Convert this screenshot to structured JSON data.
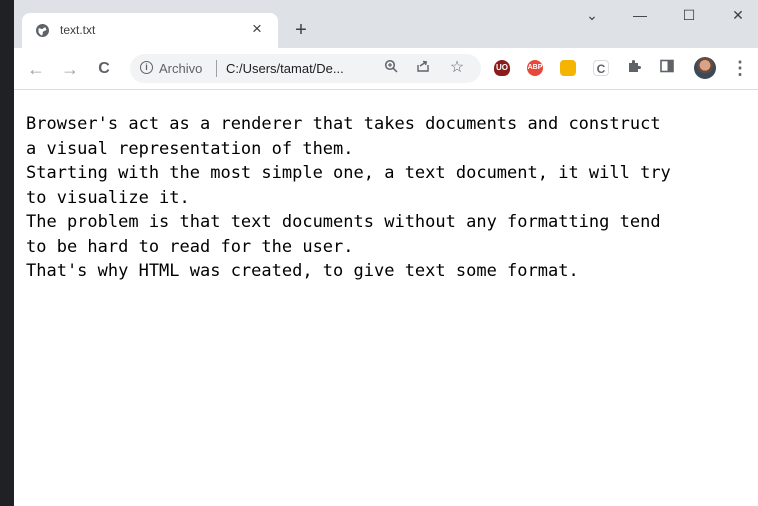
{
  "tab": {
    "title": "text.txt",
    "close": "×",
    "new_tab": "+"
  },
  "window_controls": {
    "dropdown": "⌄",
    "minimize": "—",
    "maximize": "☐",
    "close": "✕"
  },
  "nav": {
    "back": "←",
    "forward": "→",
    "reload": "C"
  },
  "omnibox": {
    "chip_label": "Archivo",
    "url": "C:/Users/tamat/De...",
    "info_icon": "i"
  },
  "extensions": {
    "ublock": "UO",
    "adblock": "ABP",
    "ext3": "",
    "ext4": "C"
  },
  "document": {
    "lines": [
      "Browser's act as a renderer that takes documents and construct",
      "a visual representation of them.",
      "Starting with the most simple one, a text document, it will try",
      "to visualize it.",
      "The problem is that text documents without any formatting tend",
      "to be hard to read for the user.",
      "That's why HTML was created, to give text some format."
    ]
  },
  "colors": {
    "titlebar": "#dee1e6",
    "toolbar": "#ffffff",
    "omnibox": "#f1f3f4",
    "page_background": "#ffffff",
    "outer_background": "#202124"
  }
}
